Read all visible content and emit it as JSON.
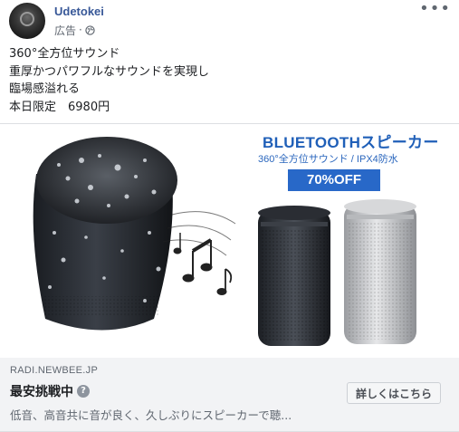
{
  "header": {
    "page_name": "Udetokei",
    "sponsored_label": "広告",
    "separator": "·",
    "privacy_icon": "globe-icon",
    "more_icon": "more-horizontal-icon",
    "more_glyph": "•••"
  },
  "body": {
    "lines": [
      "360°全方位サウンド",
      "重厚かつパワフルなサウンドを実現し",
      "臨場感溢れる",
      "本日限定　6980円"
    ]
  },
  "ad_image": {
    "title": "BLUETOOTHスピーカー",
    "subtitle": "360°全方位サウンド / IPX4防水",
    "badge": "70%OFF",
    "colors": {
      "accent": "#1f5fb8",
      "badge_bg": "#2868c8"
    }
  },
  "link": {
    "domain": "RADI.NEWBEE.JP",
    "headline": "最安挑戦中",
    "help_icon": "question-icon",
    "help_glyph": "?",
    "description": "低音、高音共に音が良く、久しぶりにスピーカーで聴...",
    "cta_label": "詳しくはこちら"
  },
  "colors": {
    "link_blue": "#385898",
    "text": "#1c1e21",
    "secondary": "#606770"
  }
}
